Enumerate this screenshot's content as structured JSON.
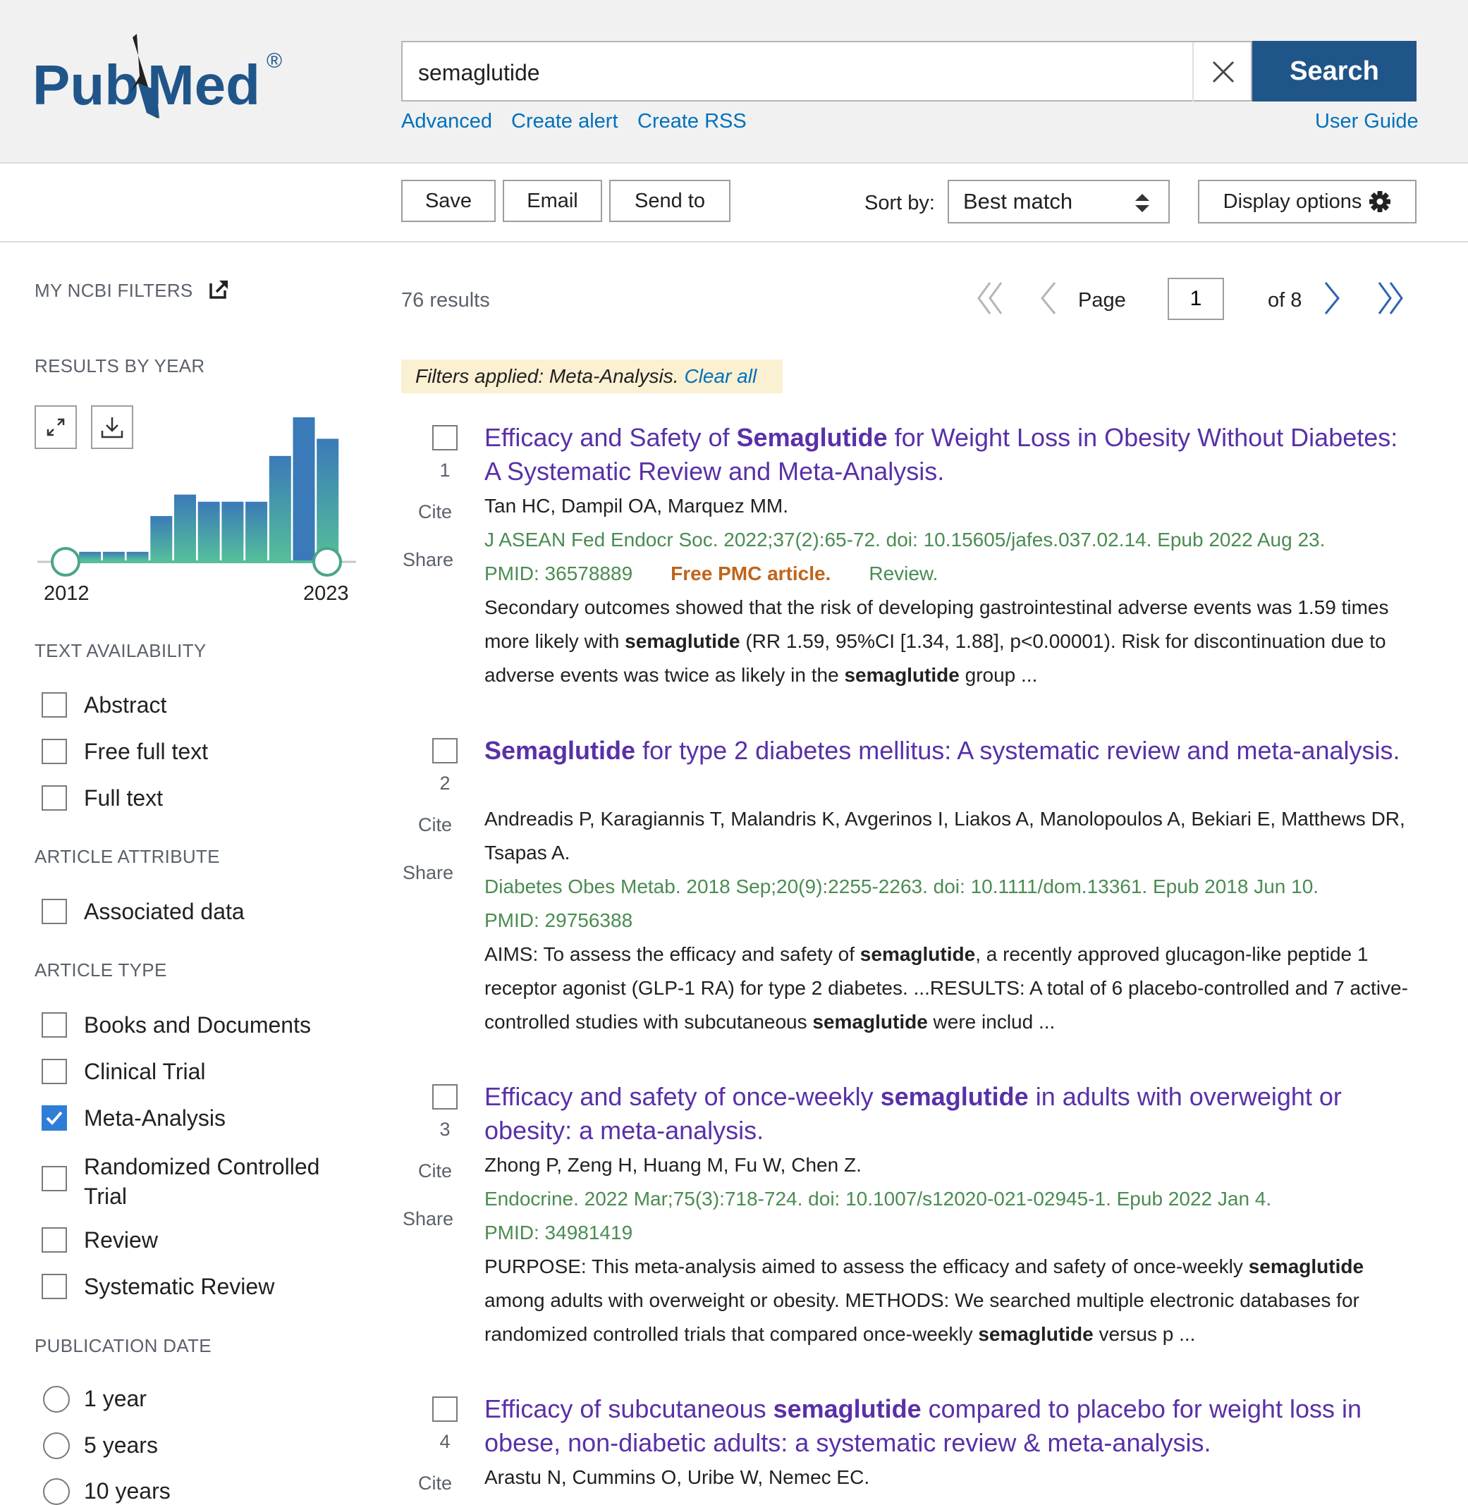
{
  "colors": {
    "accent": "#20558a",
    "link": "#0071bc",
    "title": "#5930a8",
    "citation": "#4a8c52",
    "free_pmc": "#c0641a",
    "filter_bg": "#fbf0d2"
  },
  "logo": {
    "text_left": "Pub",
    "text_right": "Med",
    "registered": "®"
  },
  "search": {
    "value": "semaglutide",
    "button": "Search"
  },
  "header_links": {
    "advanced": "Advanced",
    "create_alert": "Create alert",
    "create_rss": "Create RSS",
    "user_guide": "User Guide"
  },
  "toolbar": {
    "save": "Save",
    "email": "Email",
    "send_to": "Send to",
    "sort_label": "Sort by:",
    "sort_value": "Best match",
    "display_options": "Display options"
  },
  "sidebar": {
    "my_ncbi_filters": "MY NCBI FILTERS",
    "results_by_year": "RESULTS BY YEAR",
    "year_start": "2012",
    "year_end": "2023",
    "text_availability": "TEXT AVAILABILITY",
    "text_availability_items": [
      {
        "label": "Abstract",
        "checked": false
      },
      {
        "label": "Free full text",
        "checked": false
      },
      {
        "label": "Full text",
        "checked": false
      }
    ],
    "article_attribute": "ARTICLE ATTRIBUTE",
    "article_attribute_items": [
      {
        "label": "Associated data",
        "checked": false
      }
    ],
    "article_type": "ARTICLE TYPE",
    "article_type_items": [
      {
        "label": "Books and Documents",
        "checked": false
      },
      {
        "label": "Clinical Trial",
        "checked": false
      },
      {
        "label": "Meta-Analysis",
        "checked": true
      },
      {
        "label_line1": "Randomized Controlled",
        "label_line2": "Trial",
        "checked": false
      },
      {
        "label": "Review",
        "checked": false
      },
      {
        "label": "Systematic Review",
        "checked": false
      }
    ],
    "publication_date": "PUBLICATION DATE",
    "publication_date_items": [
      {
        "label": "1 year"
      },
      {
        "label": "5 years"
      },
      {
        "label": "10 years"
      }
    ]
  },
  "chart_data": {
    "type": "bar",
    "title": "",
    "x": [
      2012,
      2013,
      2014,
      2015,
      2016,
      2017,
      2018,
      2019,
      2020,
      2021,
      2022,
      2023
    ],
    "values": [
      0.0,
      0.06,
      0.06,
      0.06,
      0.31,
      0.46,
      0.41,
      0.41,
      0.41,
      0.73,
      1.0,
      0.85
    ],
    "value_unit": "fraction of tallest bar",
    "xlabel": "",
    "ylabel": "",
    "grid": false
  },
  "results_header": {
    "count": "76 results",
    "page_label": "Page",
    "page_value": "1",
    "of_pages": "of 8"
  },
  "filters_applied": {
    "text": "Filters applied: Meta-Analysis.",
    "clear": "Clear all"
  },
  "action_labels": {
    "cite": "Cite",
    "share": "Share"
  },
  "results": [
    {
      "num": "1",
      "title": [
        {
          "t": "Efficacy and Safety of "
        },
        {
          "t": "Semaglutide",
          "b": true
        },
        {
          "t": " for Weight Loss in Obesity Without Diabetes: A Systematic Review and Meta-Analysis."
        }
      ],
      "authors": "Tan HC, Dampil OA, Marquez MM.",
      "journal": "J ASEAN Fed Endocr Soc. 2022;37(2):65-72. doi: 10.15605/jafes.037.02.14. Epub 2022 Aug 23.",
      "pmid": "PMID: 36578889",
      "free": "Free PMC article.",
      "type": "Review.",
      "snippet": [
        {
          "t": "Secondary outcomes showed that the risk of developing gastrointestinal adverse events was 1.59 times more likely with "
        },
        {
          "t": "semaglutide",
          "b": true
        },
        {
          "t": " (RR 1.59, 95%CI [1.34, 1.88], p<0.00001). Risk for discontinuation due to adverse events was twice as likely in the "
        },
        {
          "t": "semaglutide",
          "b": true
        },
        {
          "t": " group ..."
        }
      ]
    },
    {
      "num": "2",
      "title": [
        {
          "t": "Semaglutide",
          "b": true
        },
        {
          "t": " for type 2 diabetes mellitus: A systematic review and meta-analysis."
        }
      ],
      "authors": "Andreadis P, Karagiannis T, Malandris K, Avgerinos I, Liakos A, Manolopoulos A, Bekiari E, Matthews DR, Tsapas A.",
      "journal": "Diabetes Obes Metab. 2018 Sep;20(9):2255-2263. doi: 10.1111/dom.13361. Epub 2018 Jun 10.",
      "pmid": "PMID: 29756388",
      "snippet": [
        {
          "t": "AIMS: To assess the efficacy and safety of "
        },
        {
          "t": "semaglutide",
          "b": true
        },
        {
          "t": ", a recently approved glucagon-like peptide 1 receptor agonist (GLP-1 RA) for type 2 diabetes. ...RESULTS: A total of 6 placebo-controlled and 7 active-controlled studies with subcutaneous "
        },
        {
          "t": "semaglutide",
          "b": true
        },
        {
          "t": " were includ ..."
        }
      ]
    },
    {
      "num": "3",
      "title": [
        {
          "t": "Efficacy and safety of once-weekly "
        },
        {
          "t": "semaglutide",
          "b": true
        },
        {
          "t": " in adults with overweight or obesity: a meta-analysis."
        }
      ],
      "authors": "Zhong P, Zeng H, Huang M, Fu W, Chen Z.",
      "journal": "Endocrine. 2022 Mar;75(3):718-724. doi: 10.1007/s12020-021-02945-1. Epub 2022 Jan 4.",
      "pmid": "PMID: 34981419",
      "snippet": [
        {
          "t": "PURPOSE: This meta-analysis aimed to assess the efficacy and safety of once-weekly "
        },
        {
          "t": "semaglutide",
          "b": true
        },
        {
          "t": " among adults with overweight or obesity. METHODS: We searched multiple electronic databases for randomized controlled trials that compared once-weekly "
        },
        {
          "t": "semaglutide",
          "b": true
        },
        {
          "t": " versus p ..."
        }
      ]
    },
    {
      "num": "4",
      "title": [
        {
          "t": "Efficacy of subcutaneous "
        },
        {
          "t": "semaglutide",
          "b": true
        },
        {
          "t": " compared to placebo for weight loss in obese, non-diabetic adults: a systematic review & meta-analysis."
        }
      ],
      "authors": "Arastu N, Cummins O, Uribe W, Nemec EC."
    }
  ]
}
